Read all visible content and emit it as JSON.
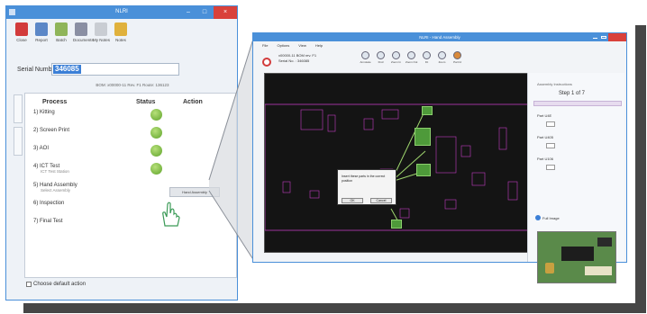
{
  "left_window": {
    "title": "NLRI",
    "toolbar": [
      {
        "label": "Close",
        "icon": "close-icon",
        "color": "#d23b3b"
      },
      {
        "label": "Report",
        "icon": "report-icon",
        "color": "#5b87c7"
      },
      {
        "label": "Batch",
        "icon": "batch-icon",
        "color": "#8fb55a"
      },
      {
        "label": "Documents",
        "icon": "paperclip-icon",
        "color": "#8a8fa3"
      },
      {
        "label": "My Notes",
        "icon": "notes-icon",
        "color": "#c9cdd3"
      },
      {
        "label": "Notes",
        "icon": "notes-folder-icon",
        "color": "#e0b13c"
      }
    ],
    "serial_label": "Serial Number:",
    "serial_value": "346085",
    "serial_info": "BOM: x00000-11 Rev. F1 Route: 136123",
    "headers": {
      "process": "Process",
      "status": "Status",
      "action": "Action"
    },
    "processes": [
      {
        "label": "1) Kitting",
        "sub": "",
        "status": "done"
      },
      {
        "label": "2) Screen Print",
        "sub": "",
        "status": "done"
      },
      {
        "label": "3) AOI",
        "sub": "",
        "status": "done"
      },
      {
        "label": "4) ICT Test",
        "sub": "ICT Test Station",
        "status": "done"
      },
      {
        "label": "5) Hand Assembly",
        "sub": "Select Assembly",
        "status": "pending"
      },
      {
        "label": "6) Inspection",
        "sub": "",
        "status": "pending"
      },
      {
        "label": "7) Final Test",
        "sub": "",
        "status": "pending"
      }
    ],
    "action_button": "Hand Assembly",
    "default_action_label": "Choose default action"
  },
  "right_window": {
    "title": "NLRI - Hand Assembly",
    "menu": [
      "File",
      "Options",
      "View",
      "Help"
    ],
    "info": [
      "x00000-11 BOM rev. F1",
      "Serial No. : 346085"
    ],
    "tool_labels": [
      "Annotate",
      "Find",
      "Zoom In",
      "Zoom Out",
      "Fit",
      "Zoom",
      "Part Id"
    ],
    "panel_header": "Assembly Instructions",
    "step": "Step 1 of 7",
    "parts": [
      "Part U4E",
      "Part U405",
      "Part U106"
    ],
    "view_button": "Full Image",
    "dialog_text": "Insert these parts in the correct position",
    "dialog_ok": "OK",
    "dialog_cancel": "Cancel"
  }
}
